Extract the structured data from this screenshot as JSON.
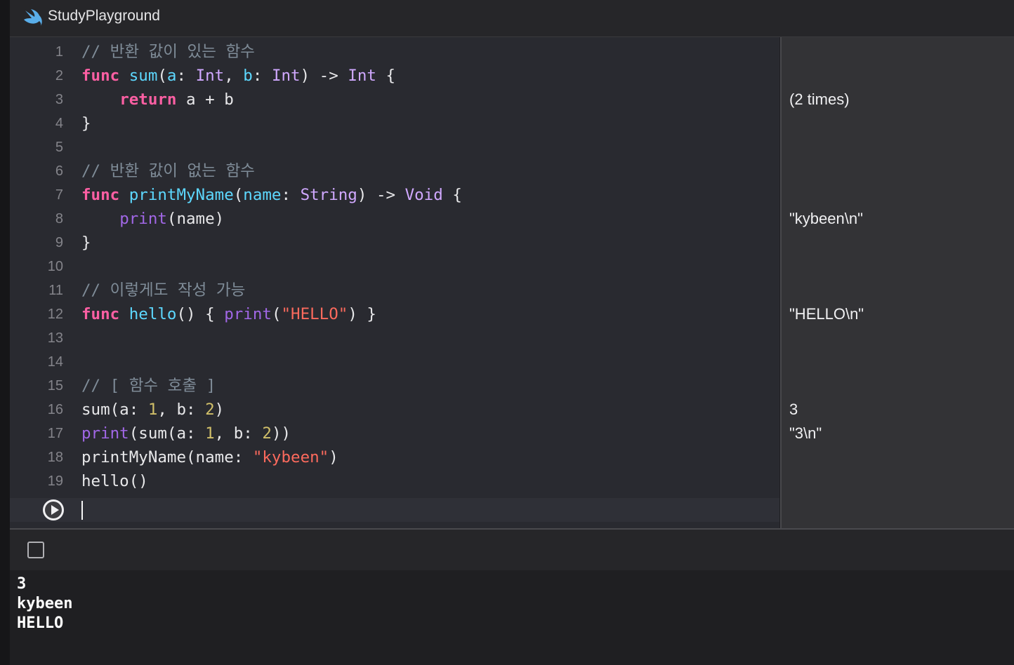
{
  "window": {
    "title": "StudyPlayground",
    "icon": "swift-icon"
  },
  "editor": {
    "lines": [
      {
        "n": "1",
        "tokens": [
          {
            "t": "cm",
            "v": "// 반환 값이 있는 함수"
          }
        ]
      },
      {
        "n": "2",
        "tokens": [
          {
            "t": "kw",
            "v": "func"
          },
          {
            "t": "p",
            "v": " "
          },
          {
            "t": "decl",
            "v": "sum"
          },
          {
            "t": "p",
            "v": "("
          },
          {
            "t": "decl",
            "v": "a"
          },
          {
            "t": "p",
            "v": ": "
          },
          {
            "t": "typ",
            "v": "Int"
          },
          {
            "t": "p",
            "v": ", "
          },
          {
            "t": "decl",
            "v": "b"
          },
          {
            "t": "p",
            "v": ": "
          },
          {
            "t": "typ",
            "v": "Int"
          },
          {
            "t": "p",
            "v": ") -> "
          },
          {
            "t": "typ",
            "v": "Int"
          },
          {
            "t": "p",
            "v": " {"
          }
        ]
      },
      {
        "n": "3",
        "tokens": [
          {
            "t": "p",
            "v": "    "
          },
          {
            "t": "kw",
            "v": "return"
          },
          {
            "t": "p",
            "v": " a + b"
          }
        ]
      },
      {
        "n": "4",
        "tokens": [
          {
            "t": "p",
            "v": "}"
          }
        ]
      },
      {
        "n": "5",
        "tokens": []
      },
      {
        "n": "6",
        "tokens": [
          {
            "t": "cm",
            "v": "// 반환 값이 없는 함수"
          }
        ]
      },
      {
        "n": "7",
        "tokens": [
          {
            "t": "kw",
            "v": "func"
          },
          {
            "t": "p",
            "v": " "
          },
          {
            "t": "decl",
            "v": "printMyName"
          },
          {
            "t": "p",
            "v": "("
          },
          {
            "t": "decl",
            "v": "name"
          },
          {
            "t": "p",
            "v": ": "
          },
          {
            "t": "typ",
            "v": "String"
          },
          {
            "t": "p",
            "v": ") -> "
          },
          {
            "t": "typ",
            "v": "Void"
          },
          {
            "t": "p",
            "v": " {"
          }
        ]
      },
      {
        "n": "8",
        "tokens": [
          {
            "t": "p",
            "v": "    "
          },
          {
            "t": "call",
            "v": "print"
          },
          {
            "t": "p",
            "v": "(name)"
          }
        ]
      },
      {
        "n": "9",
        "tokens": [
          {
            "t": "p",
            "v": "}"
          }
        ]
      },
      {
        "n": "10",
        "tokens": []
      },
      {
        "n": "11",
        "tokens": [
          {
            "t": "cm",
            "v": "// 이렇게도 작성 가능"
          }
        ]
      },
      {
        "n": "12",
        "tokens": [
          {
            "t": "kw",
            "v": "func"
          },
          {
            "t": "p",
            "v": " "
          },
          {
            "t": "decl",
            "v": "hello"
          },
          {
            "t": "p",
            "v": "() { "
          },
          {
            "t": "call",
            "v": "print"
          },
          {
            "t": "p",
            "v": "("
          },
          {
            "t": "str",
            "v": "\"HELLO\""
          },
          {
            "t": "p",
            "v": ") }"
          }
        ]
      },
      {
        "n": "13",
        "tokens": []
      },
      {
        "n": "14",
        "tokens": []
      },
      {
        "n": "15",
        "tokens": [
          {
            "t": "cm",
            "v": "// [ 함수 호출 ]"
          }
        ]
      },
      {
        "n": "16",
        "tokens": [
          {
            "t": "p",
            "v": "sum(a: "
          },
          {
            "t": "num",
            "v": "1"
          },
          {
            "t": "p",
            "v": ", b: "
          },
          {
            "t": "num",
            "v": "2"
          },
          {
            "t": "p",
            "v": ")"
          }
        ]
      },
      {
        "n": "17",
        "tokens": [
          {
            "t": "call",
            "v": "print"
          },
          {
            "t": "p",
            "v": "(sum(a: "
          },
          {
            "t": "num",
            "v": "1"
          },
          {
            "t": "p",
            "v": ", b: "
          },
          {
            "t": "num",
            "v": "2"
          },
          {
            "t": "p",
            "v": "))"
          }
        ]
      },
      {
        "n": "18",
        "tokens": [
          {
            "t": "p",
            "v": "printMyName(name: "
          },
          {
            "t": "str",
            "v": "\"kybeen\""
          },
          {
            "t": "p",
            "v": ")"
          }
        ]
      },
      {
        "n": "19",
        "tokens": [
          {
            "t": "p",
            "v": "hello()"
          }
        ]
      }
    ],
    "run_button_icon": "play-icon"
  },
  "results": [
    {
      "line": 3,
      "text": "(2 times)"
    },
    {
      "line": 8,
      "text": "\"kybeen\\n\""
    },
    {
      "line": 12,
      "text": "\"HELLO\\n\""
    },
    {
      "line": 16,
      "text": "3"
    },
    {
      "line": 17,
      "text": "\"3\\n\""
    }
  ],
  "console": {
    "toggle_icon": "hide-console-icon",
    "output": [
      "3",
      "kybeen",
      "HELLO"
    ]
  }
}
